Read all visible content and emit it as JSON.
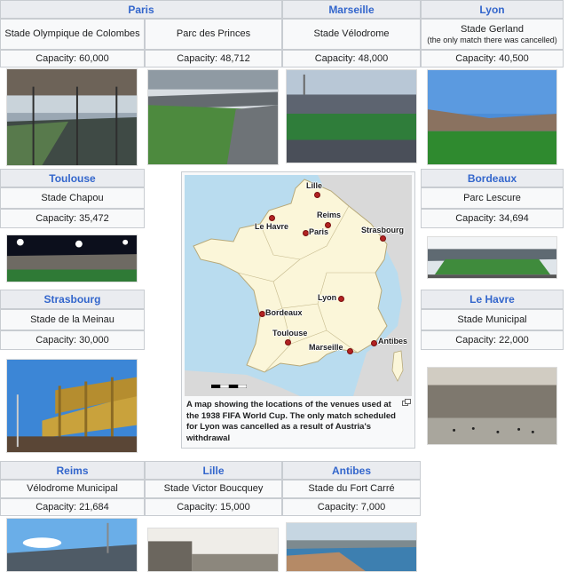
{
  "venues": {
    "paris": {
      "city": "Paris",
      "stadium": "Stade Olympique de Colombes",
      "capacity": "Capacity: 60,000"
    },
    "paris2": {
      "stadium": "Parc des Princes",
      "capacity": "Capacity: 48,712"
    },
    "marseille": {
      "city": "Marseille",
      "stadium": "Stade Vélodrome",
      "capacity": "Capacity: 48,000"
    },
    "lyon": {
      "city": "Lyon",
      "stadium": "Stade Gerland",
      "note": "(the only match there was cancelled)",
      "capacity": "Capacity: 40,500"
    },
    "toulouse": {
      "city": "Toulouse",
      "stadium": "Stade Chapou",
      "capacity": "Capacity: 35,472"
    },
    "bordeaux": {
      "city": "Bordeaux",
      "stadium": "Parc Lescure",
      "capacity": "Capacity: 34,694"
    },
    "strasbourg": {
      "city": "Strasbourg",
      "stadium": "Stade de la Meinau",
      "capacity": "Capacity: 30,000"
    },
    "lehavre": {
      "city": "Le Havre",
      "stadium": "Stade Municipal",
      "capacity": "Capacity: 22,000"
    },
    "reims": {
      "city": "Reims",
      "stadium": "Vélodrome Municipal",
      "capacity": "Capacity: 21,684"
    },
    "lille": {
      "city": "Lille",
      "stadium": "Stade Victor Boucquey",
      "capacity": "Capacity: 15,000"
    },
    "antibes": {
      "city": "Antibes",
      "stadium": "Stade du Fort Carré",
      "capacity": "Capacity: 7,000"
    }
  },
  "map": {
    "labels": {
      "lille": "Lille",
      "reims": "Reims",
      "lehavre": "Le Havre",
      "paris": "Paris",
      "strasbourg": "Strasbourg",
      "lyon": "Lyon",
      "bordeaux": "Bordeaux",
      "toulouse": "Toulouse",
      "marseille": "Marseille",
      "antibes": "Antibes"
    },
    "caption": "A map showing the locations of the venues used at the 1938 FIFA World Cup. The only match scheduled for Lyon was cancelled as a result of Austria's withdrawal"
  },
  "colors": {
    "header_bg": "#eaecf0",
    "header_text": "#3366cc",
    "cell_bg": "#f8f9fa",
    "border": "#c8ccd1",
    "france_fill": "#fbf6d9",
    "sea": "#b9dcef",
    "neighbors": "#d9d9d9",
    "venue_dot": "#b22222"
  },
  "icons": {
    "enlarge": "enlarge-icon"
  }
}
